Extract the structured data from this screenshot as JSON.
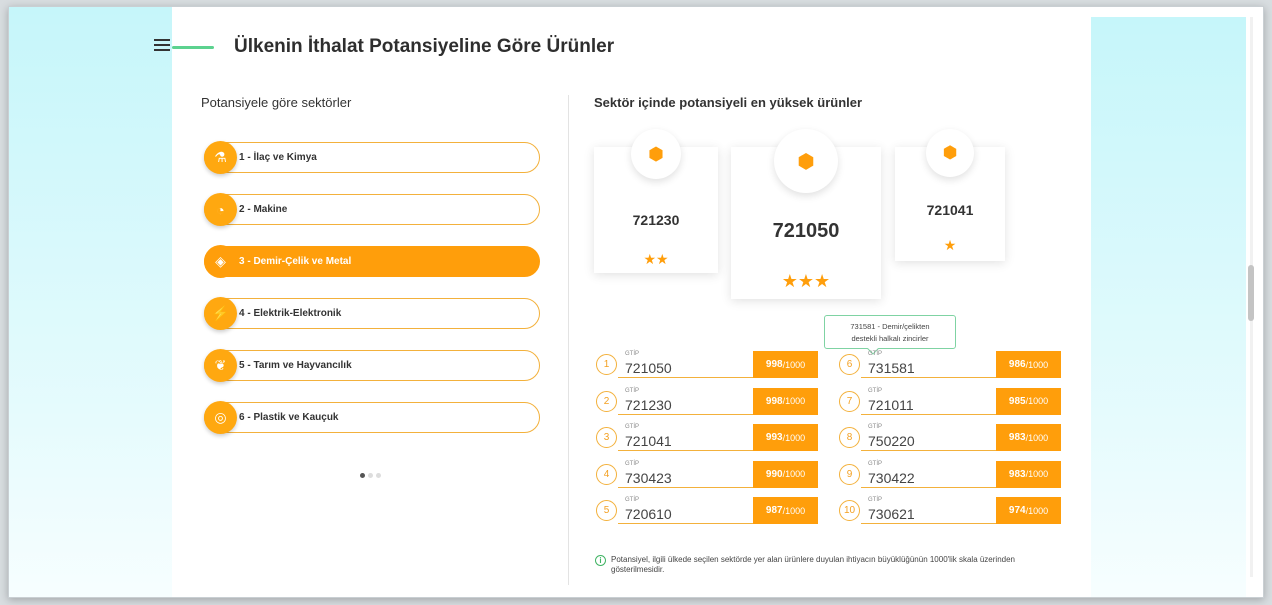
{
  "header": {
    "title": "Ülkenin İthalat Potansiyeline Göre Ürünler"
  },
  "left": {
    "title": "Potansiyele göre sektörler",
    "sectors": [
      {
        "label": "1 - İlaç ve Kimya",
        "icon": "flask-icon",
        "glyph": "⚗"
      },
      {
        "label": "2 - Makine",
        "icon": "speedometer-icon",
        "glyph": "◔"
      },
      {
        "label": "3 - Demir-Çelik ve Metal",
        "icon": "metal-bar-icon",
        "glyph": "◈"
      },
      {
        "label": "4 - Elektrik-Elektronik",
        "icon": "plug-icon",
        "glyph": "⚡"
      },
      {
        "label": "5 - Tarım ve Hayvancılık",
        "icon": "wheat-icon",
        "glyph": "❦"
      },
      {
        "label": "6 - Plastik ve Kauçuk",
        "icon": "spiral-icon",
        "glyph": "◎"
      }
    ],
    "active_sector": 2
  },
  "right": {
    "title": "Sektör içinde potansiyeli en yüksek ürünler",
    "top_cards": [
      {
        "code": "721230",
        "stars": "★★"
      },
      {
        "code": "721050",
        "stars": "★★★"
      },
      {
        "code": "721041",
        "stars": "★"
      }
    ],
    "tooltip": {
      "line1": "731581 - Demir/çelikten",
      "line2": "destekli halkalı zincirler"
    },
    "gtip_label": "GTİP",
    "score_suffix": "/1000",
    "rankings": [
      {
        "rank": "1",
        "code": "721050",
        "score": "998"
      },
      {
        "rank": "2",
        "code": "721230",
        "score": "998"
      },
      {
        "rank": "3",
        "code": "721041",
        "score": "993"
      },
      {
        "rank": "4",
        "code": "730423",
        "score": "990"
      },
      {
        "rank": "5",
        "code": "720610",
        "score": "987"
      },
      {
        "rank": "6",
        "code": "731581",
        "score": "986"
      },
      {
        "rank": "7",
        "code": "721011",
        "score": "985"
      },
      {
        "rank": "8",
        "code": "750220",
        "score": "983"
      },
      {
        "rank": "9",
        "code": "730422",
        "score": "983"
      },
      {
        "rank": "10",
        "code": "730621",
        "score": "974"
      }
    ],
    "info_text": "Potansiyel, ilgili ülkede seçilen sektörde yer alan ürünlere duyulan ihtiyacın büyüklüğünün 1000'lik skala üzerinden gösterilmesidir."
  },
  "colors": {
    "accent": "#ff9e0b",
    "green": "#5cd28f"
  }
}
